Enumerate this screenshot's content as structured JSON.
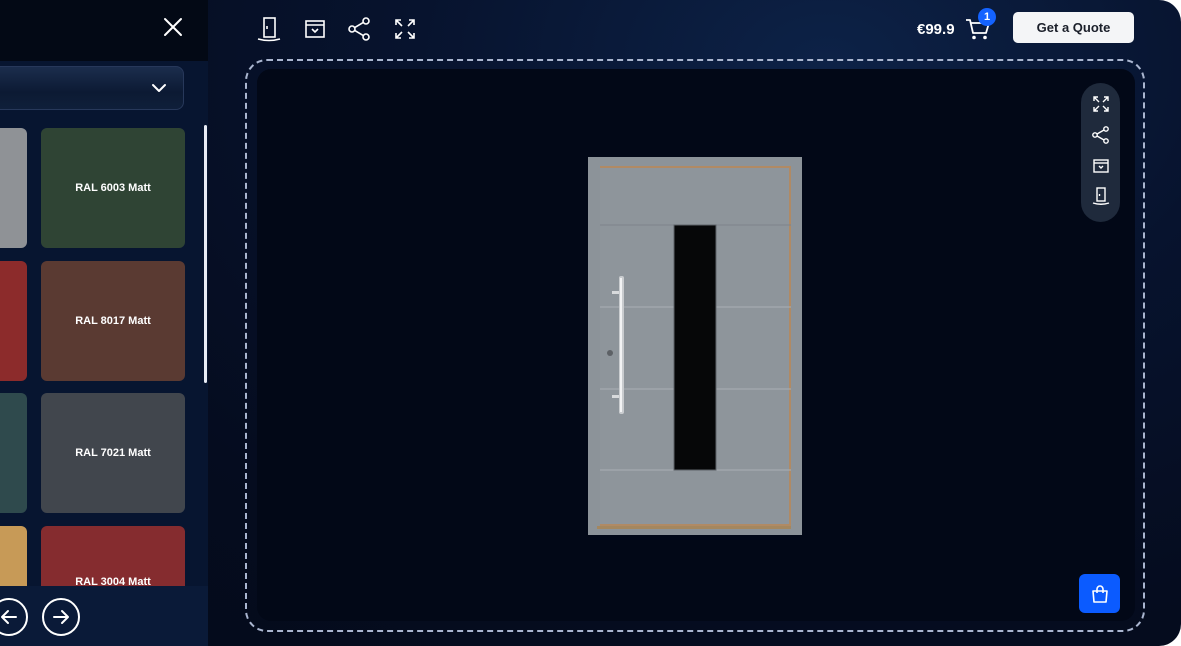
{
  "panel": {
    "swatches": [
      {
        "label": "",
        "color": "#8f9296"
      },
      {
        "label": "RAL 6003 Matt",
        "color": "#2f4434"
      },
      {
        "label": "",
        "color": "#8c2b2b"
      },
      {
        "label": "RAL 8017 Matt",
        "color": "#5a3a32"
      },
      {
        "label": "",
        "color": "#2f4a4d"
      },
      {
        "label": "RAL 7021 Matt",
        "color": "#41464d"
      },
      {
        "label": "",
        "color": "#c79a57"
      },
      {
        "label": "RAL 3004 Matt",
        "color": "#852c2f"
      }
    ]
  },
  "toolbar": {
    "icons": [
      "door-icon",
      "archive-icon",
      "share-icon",
      "fullscreen-icon"
    ],
    "price": "€99.9",
    "cart_count": "1",
    "quote_label": "Get a Quote"
  },
  "viewer": {
    "side_icons": [
      "fullscreen-icon",
      "share-icon",
      "archive-icon",
      "door-icon"
    ],
    "door_color": "#8e959b",
    "accent_color": "#0b5bff"
  }
}
